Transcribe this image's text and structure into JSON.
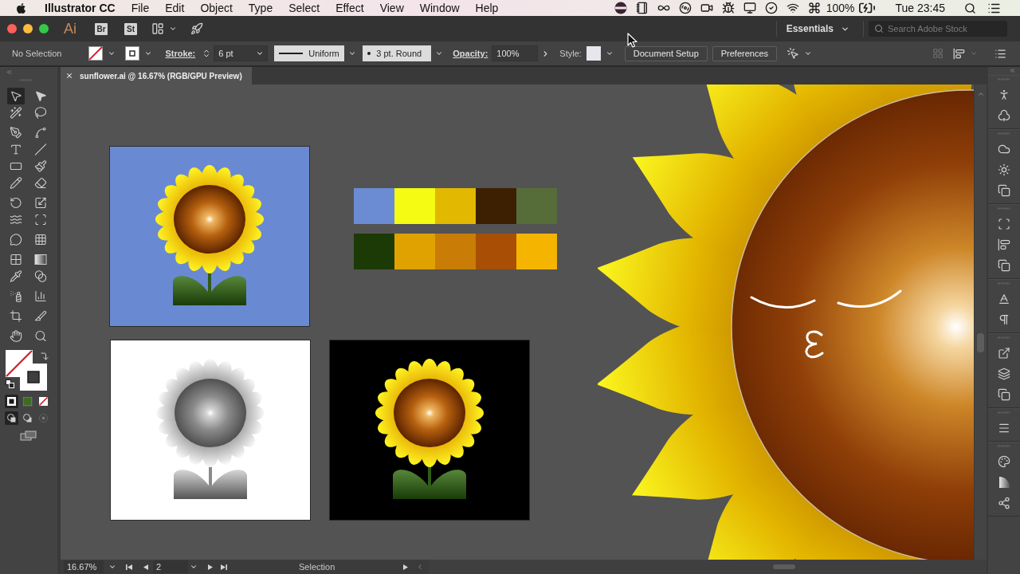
{
  "menu_bar": {
    "app_name": "Illustrator CC",
    "menus": [
      "File",
      "Edit",
      "Object",
      "Type",
      "Select",
      "Effect",
      "View",
      "Window",
      "Help"
    ],
    "battery": "100%",
    "clock": "Tue 23:45"
  },
  "app_bar": {
    "logo": "Ai",
    "bridge": "Br",
    "stock": "St",
    "workspace": "Essentials",
    "search": {
      "placeholder": "Search Adobe Stock"
    }
  },
  "control_bar": {
    "selection": "No Selection",
    "stroke_label": "Stroke:",
    "stroke_weight": "6 pt",
    "profile": "Uniform",
    "brush": "3 pt. Round",
    "opacity_label": "Opacity:",
    "opacity": "100%",
    "style_label": "Style:",
    "buttons": [
      "Document Setup",
      "Preferences"
    ]
  },
  "document_tab": {
    "title": "sunflower.ai @ 16.67% (RGB/GPU Preview)"
  },
  "toolbar": {
    "tools": [
      {
        "selected": true
      },
      {
        "selected": false
      },
      {
        "selected": false
      },
      {
        "selected": false
      },
      {
        "selected": false
      },
      {
        "selected": false
      },
      {
        "selected": false
      },
      {
        "selected": false
      },
      {
        "selected": false
      },
      {
        "selected": false
      },
      {
        "selected": false
      },
      {
        "selected": false
      },
      {
        "selected": false
      },
      {
        "selected": false
      },
      {
        "selected": false
      },
      {
        "selected": false
      },
      {
        "selected": false
      },
      {
        "selected": false
      },
      {
        "selected": false
      },
      {
        "selected": false
      },
      {
        "selected": false
      },
      {
        "selected": false
      },
      {
        "selected": false
      },
      {
        "selected": false
      },
      {
        "selected": false
      },
      {
        "selected": false
      },
      {
        "selected": false
      },
      {
        "selected": false
      }
    ],
    "color_modes": [
      {
        "selected": true
      },
      {
        "selected": false
      },
      {
        "selected": false
      }
    ],
    "draw_modes": [
      {
        "selected": true
      },
      {
        "selected": false
      },
      {
        "selected": false
      }
    ]
  },
  "canvas": {
    "artboards": [
      {
        "kind": "color",
        "color": "#6a89d3"
      },
      {
        "kind": "grayscale",
        "color": "#ffffff"
      },
      {
        "kind": "color",
        "color": "#000000"
      }
    ],
    "palette_rows": [
      {
        "swatches": [
          {
            "color": "#6b8bd3"
          },
          {
            "color": "#f5fb12"
          },
          {
            "color": "#e2b800"
          },
          {
            "color": "#3d1f02"
          },
          {
            "color": "#566d3a"
          }
        ]
      },
      {
        "swatches": [
          {
            "color": "#1c3a06"
          },
          {
            "color": "#e0a200"
          },
          {
            "color": "#c97d07"
          },
          {
            "color": "#a84f05"
          },
          {
            "color": "#f5b400"
          }
        ]
      }
    ]
  },
  "status_bar": {
    "zoom": "16.67%",
    "artboard": "2",
    "tool": "Selection"
  }
}
